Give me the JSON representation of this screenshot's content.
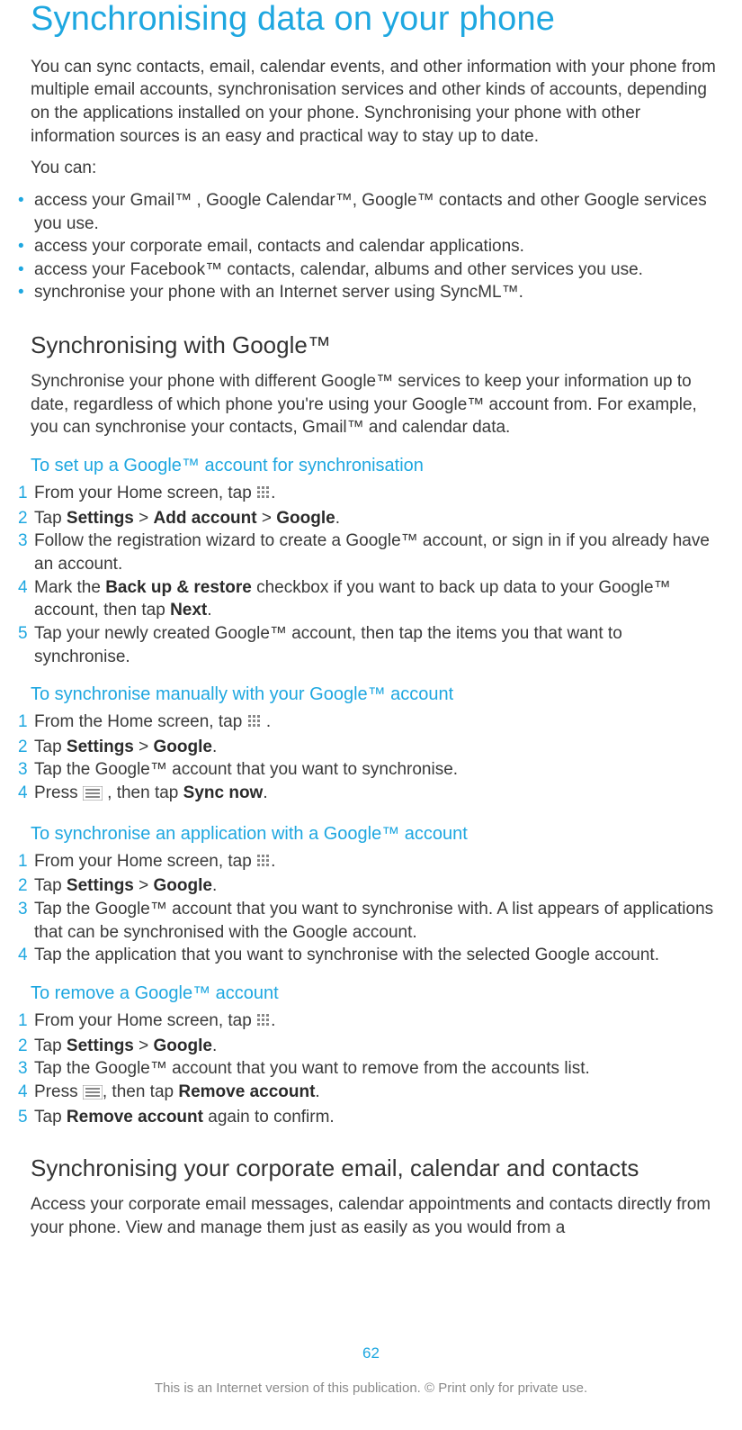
{
  "title": "Synchronising data on your phone",
  "intro1": "You can sync contacts, email, calendar events, and other information with your phone from multiple email accounts, synchronisation services and other kinds of accounts, depending on the applications installed on your phone. Synchronising your phone with other information sources is an easy and practical way to stay up to date.",
  "intro2": "You can:",
  "bullets": [
    "access your Gmail™ , Google Calendar™, Google™ contacts and other Google services you use.",
    "access your corporate email, contacts and calendar applications.",
    "access your Facebook™ contacts, calendar, albums and other services you use.",
    "synchronise your phone with an Internet server using SyncML™."
  ],
  "google": {
    "heading": "Synchronising with Google™",
    "para": "Synchronise your phone with different Google™ services to keep your information up to date, regardless of which phone you're using your Google™ account from. For example, you can synchronise your contacts, Gmail™ and calendar data.",
    "setup": {
      "title": "To set up a Google™ account for synchronisation",
      "s1a": "From your Home screen, tap ",
      "s1b": ".",
      "s2a": "Tap ",
      "s2_settings": "Settings",
      "s2_gt1": " > ",
      "s2_add": "Add account",
      "s2_gt2": " > ",
      "s2_google": "Google",
      "s2b": ".",
      "s3": "Follow the registration wizard to create a Google™ account, or sign in if you already have an account.",
      "s4a": "Mark the ",
      "s4_backup": "Back up & restore",
      "s4b": " checkbox if you want to back up data to your Google™ account, then tap ",
      "s4_next": "Next",
      "s4c": ".",
      "s5": "Tap your newly created Google™ account, then tap the items you that want to synchronise."
    },
    "manual": {
      "title": "To synchronise manually with your Google™ account",
      "s1a": "From the Home screen, tap ",
      "s1b": " .",
      "s2a": "Tap ",
      "s2_settings": "Settings",
      "s2_gt": " > ",
      "s2_google": "Google",
      "s2b": ".",
      "s3": "Tap the Google™ account that you want to synchronise.",
      "s4a": "Press ",
      "s4b": " , then tap ",
      "s4_sync": "Sync now",
      "s4c": "."
    },
    "appsync": {
      "title": "To synchronise an application with a Google™ account",
      "s1a": "From your Home screen, tap ",
      "s1b": ".",
      "s2a": "Tap ",
      "s2_settings": "Settings",
      "s2_gt": " > ",
      "s2_google": "Google",
      "s2b": ".",
      "s3": "Tap the Google™ account that you want to synchronise with. A list appears of applications that can be synchronised with the Google account.",
      "s4": "Tap the application that you want to synchronise with the selected Google account."
    },
    "remove": {
      "title": "To remove a Google™ account",
      "s1a": "From your Home screen, tap ",
      "s1b": ".",
      "s2a": "Tap ",
      "s2_settings": "Settings",
      "s2_gt": " > ",
      "s2_google": "Google",
      "s2b": ".",
      "s3": "Tap the Google™ account that you want to remove from the accounts list.",
      "s4a": "Press ",
      "s4b": ", then tap ",
      "s4_remove": "Remove account",
      "s4c": ".",
      "s5a": "Tap ",
      "s5_remove": "Remove account",
      "s5b": " again to confirm."
    }
  },
  "corp": {
    "heading": "Synchronising your corporate email, calendar and contacts",
    "para": "Access your corporate email messages, calendar appointments and contacts directly from your phone. View and manage them just as easily as you would from a"
  },
  "footer": {
    "page": "62",
    "disclaimer": "This is an Internet version of this publication. © Print only for private use."
  }
}
